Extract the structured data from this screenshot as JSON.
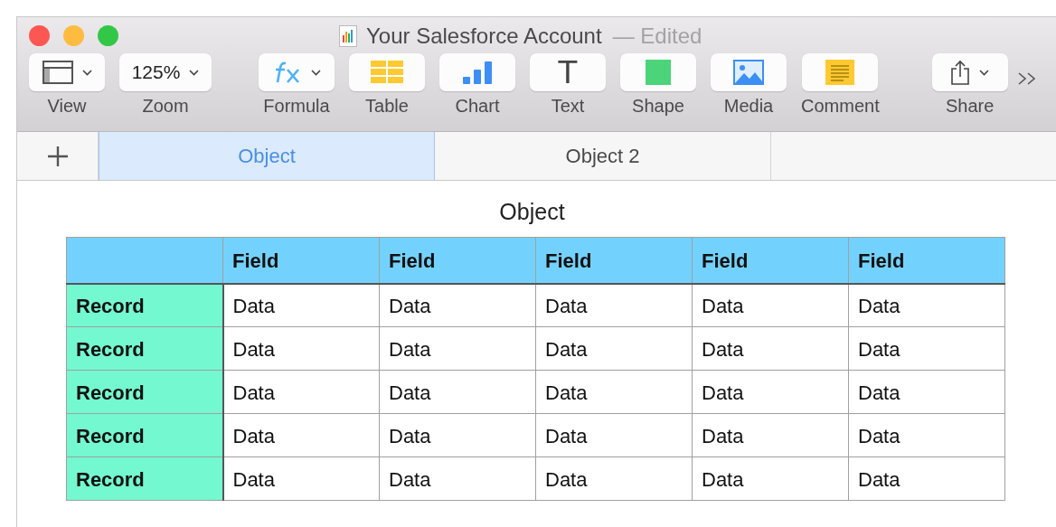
{
  "window": {
    "title": "Your Salesforce Account",
    "status": "— Edited"
  },
  "toolbar": [
    {
      "kind": "view",
      "label": "View"
    },
    {
      "kind": "zoom",
      "label": "Zoom",
      "value": "125%"
    },
    {
      "kind": "formula",
      "label": "Formula"
    },
    {
      "kind": "table",
      "label": "Table"
    },
    {
      "kind": "chart",
      "label": "Chart"
    },
    {
      "kind": "text",
      "label": "Text",
      "glyph": "T"
    },
    {
      "kind": "shape",
      "label": "Shape"
    },
    {
      "kind": "media",
      "label": "Media"
    },
    {
      "kind": "comment",
      "label": "Comment"
    },
    {
      "kind": "share",
      "label": "Share"
    }
  ],
  "tabs": [
    {
      "label": "Object",
      "selected": true
    },
    {
      "label": "Object 2",
      "selected": false
    }
  ],
  "sheet": {
    "title": "Object",
    "columns": [
      "",
      "Field",
      "Field",
      "Field",
      "Field",
      "Field"
    ],
    "rows": [
      [
        "Record",
        "Data",
        "Data",
        "Data",
        "Data",
        "Data"
      ],
      [
        "Record",
        "Data",
        "Data",
        "Data",
        "Data",
        "Data"
      ],
      [
        "Record",
        "Data",
        "Data",
        "Data",
        "Data",
        "Data"
      ],
      [
        "Record",
        "Data",
        "Data",
        "Data",
        "Data",
        "Data"
      ],
      [
        "Record",
        "Data",
        "Data",
        "Data",
        "Data",
        "Data"
      ]
    ]
  }
}
